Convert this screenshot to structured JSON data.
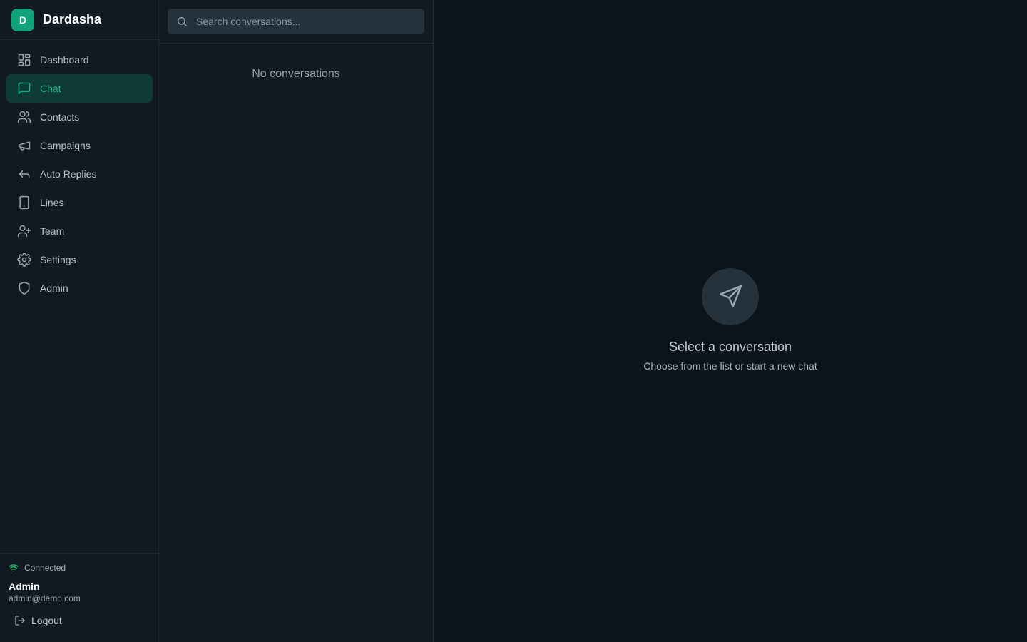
{
  "brand": {
    "initial": "D",
    "name": "Dardasha"
  },
  "colors": {
    "accent": "#10a37a",
    "active_bg": "#0f3b35",
    "connected": "#22c55e"
  },
  "nav": [
    {
      "label": "Dashboard",
      "icon": "dashboard-icon"
    },
    {
      "label": "Chat",
      "icon": "chat-icon",
      "active": true
    },
    {
      "label": "Contacts",
      "icon": "contacts-icon"
    },
    {
      "label": "Campaigns",
      "icon": "megaphone-icon"
    },
    {
      "label": "Auto Replies",
      "icon": "reply-icon"
    },
    {
      "label": "Lines",
      "icon": "phone-icon"
    },
    {
      "label": "Team",
      "icon": "user-plus-icon"
    },
    {
      "label": "Settings",
      "icon": "gear-icon"
    },
    {
      "label": "Admin",
      "icon": "shield-icon"
    }
  ],
  "footer": {
    "status": "Connected",
    "user_name": "Admin",
    "user_email": "admin@demo.com",
    "logout_label": "Logout"
  },
  "conversations": {
    "search_placeholder": "Search conversations...",
    "empty_text": "No conversations"
  },
  "main": {
    "title": "Select a conversation",
    "subtitle": "Choose from the list or start a new chat"
  }
}
